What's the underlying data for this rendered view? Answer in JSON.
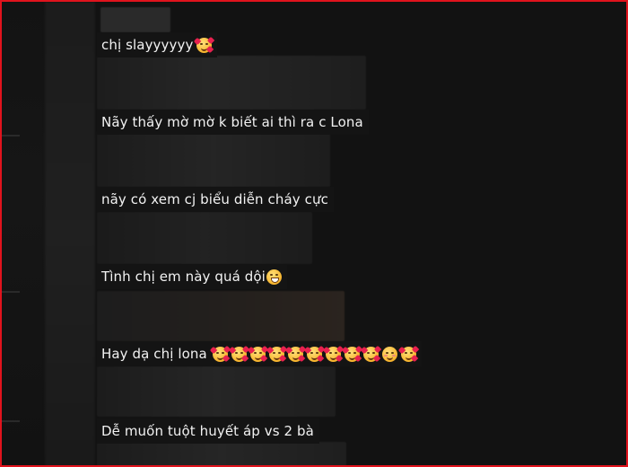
{
  "comments": [
    {
      "text": "chị slayyyyyy",
      "emojis": [
        "smiling-face-with-hearts"
      ]
    },
    {
      "text": "Nãy thấy mờ mờ k biết ai thì ra c Lona",
      "emojis": []
    },
    {
      "text": "nãy có xem cj biểu diễn cháy cực",
      "emojis": []
    },
    {
      "text": "Tình chị em này quá dội",
      "emojis": [
        "grinning-squinting-face"
      ]
    },
    {
      "text": "Hay dạ chị lona",
      "emojis": [
        "smiling-face-with-hearts",
        "smiling-face-with-hearts",
        "smiling-face-with-hearts",
        "smiling-face-with-hearts",
        "smiling-face-with-hearts",
        "smiling-face-with-hearts",
        "smiling-face-with-hearts",
        "smiling-face-with-hearts",
        "smiling-face-with-hearts",
        "smiling-face-with-smiling-eyes",
        "smiling-face-with-hearts"
      ]
    },
    {
      "text": "Dễ muốn tuột huyết áp vs 2 bà",
      "emojis": []
    }
  ],
  "colors": {
    "frame_border": "#e0131d",
    "background": "#121212",
    "text": "#f2f2f2"
  }
}
